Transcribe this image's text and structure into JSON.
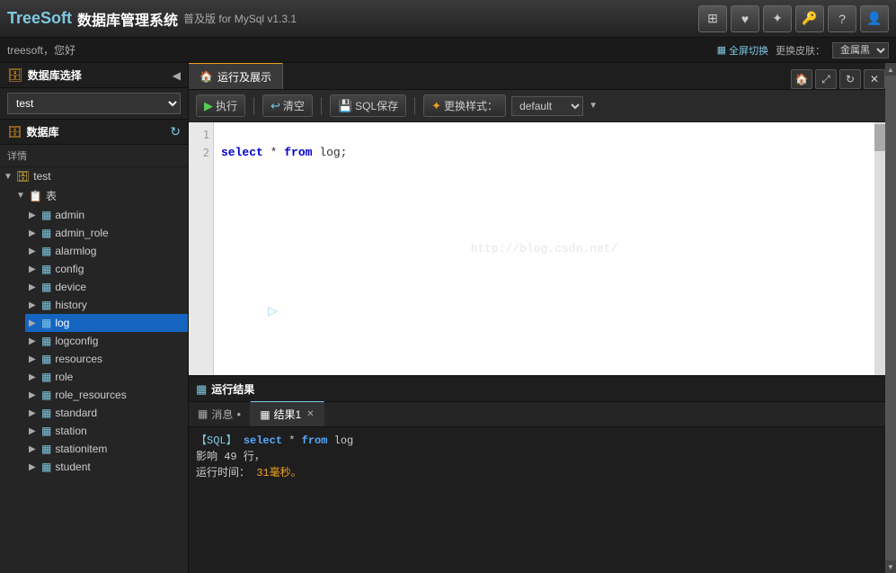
{
  "app": {
    "logo": "TreeSoft",
    "title": "数据库管理系统",
    "subtitle": "普及版 for MySql v1.3.1"
  },
  "toolbar": {
    "icons": [
      "⊞",
      "♥",
      "✦",
      "🔑",
      "?",
      "👤"
    ]
  },
  "infobar": {
    "user": "treesoft，您好",
    "fullscreen_label": "全屏切换",
    "skin_label": "更换皮肤：",
    "skin_option": "金属黑",
    "grid_icon": "▦"
  },
  "sidebar": {
    "db_selector_label": "数据库选择",
    "current_db": "test",
    "db_section_label": "数据库",
    "details_label": "详情",
    "tree": {
      "root": "test",
      "folder": "表",
      "items": [
        {
          "name": "admin",
          "selected": false
        },
        {
          "name": "admin_role",
          "selected": false
        },
        {
          "name": "alarmlog",
          "selected": false
        },
        {
          "name": "config",
          "selected": false
        },
        {
          "name": "device",
          "selected": false
        },
        {
          "name": "history",
          "selected": false
        },
        {
          "name": "log",
          "selected": true
        },
        {
          "name": "logconfig",
          "selected": false
        },
        {
          "name": "resources",
          "selected": false
        },
        {
          "name": "role",
          "selected": false
        },
        {
          "name": "role_resources",
          "selected": false
        },
        {
          "name": "standard",
          "selected": false
        },
        {
          "name": "station",
          "selected": false
        },
        {
          "name": "stationitem",
          "selected": false
        },
        {
          "name": "student",
          "selected": false
        }
      ]
    }
  },
  "content": {
    "tab_label": "运行及展示",
    "tab_icon": "🏠",
    "actions": {
      "execute": "执行",
      "clear": "清空",
      "sql_save": "SQL保存",
      "change_style": "更换样式：",
      "style_default": "default"
    },
    "editor": {
      "lines": [
        "",
        "select * from log;"
      ],
      "line_numbers": [
        "1",
        "2"
      ]
    },
    "result_section": {
      "label": "运行结果",
      "tabs": [
        {
          "label": "消息",
          "active": false,
          "closable": false
        },
        {
          "label": "结果1",
          "active": true,
          "closable": true
        }
      ],
      "output_lines": [
        {
          "text": "【SQL】 select * from log",
          "type": "info"
        },
        {
          "text": "影响 49 行，",
          "type": "normal"
        },
        {
          "text": "运行时间：31毫秒。",
          "type": "normal"
        },
        {
          "text": "",
          "type": "normal"
        },
        {
          "text": "",
          "type": "normal"
        }
      ]
    }
  },
  "watermark": "http://blog.csdn.net/",
  "colors": {
    "accent_blue": "#7ec8e3",
    "accent_orange": "#f0a020",
    "selected_bg": "#1565c0",
    "header_bg": "#1e1e1e",
    "sidebar_bg": "#252525",
    "editor_bg": "#ffffff"
  }
}
